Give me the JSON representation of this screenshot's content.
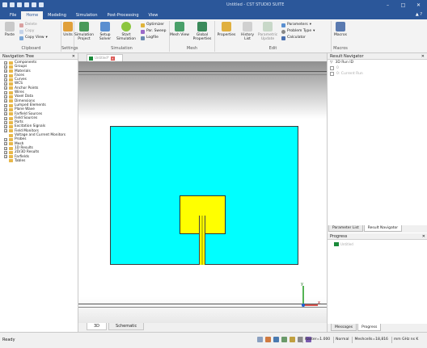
{
  "app": {
    "title": "CST STUDIO SUITE",
    "file_name": "Untitled"
  },
  "ribbon_tabs": [
    "File",
    "Home",
    "Modeling",
    "Simulation",
    "Post-Processing",
    "View"
  ],
  "active_tab": "Home",
  "ribbon": {
    "clipboard": {
      "label": "Clipboard",
      "paste": "Paste",
      "delete": "Delete",
      "copy": "Copy",
      "copy_view": "Copy View"
    },
    "settings": {
      "label": "Settings",
      "units": "Units"
    },
    "simulation": {
      "label": "Simulation",
      "project": "Simulation Project",
      "setup_solver": "Setup Solver",
      "start_simulation": "Start Simulation",
      "optimizer": "Optimizer",
      "par_sweep": "Par. Sweep",
      "logfile": "Logfile"
    },
    "mesh": {
      "label": "Mesh",
      "mesh_view": "Mesh View",
      "global_properties": "Global Properties"
    },
    "edit": {
      "label": "Edit",
      "properties": "Properties",
      "history_list": "History List",
      "parametric_update": "Parametric Update",
      "parameters": "Parameters",
      "problem_type": "Problem Type",
      "calculator": "Calculator"
    },
    "macros": {
      "label": "Macros",
      "macros": "Macros"
    }
  },
  "navigation_tree": {
    "title": "Navigation Tree",
    "items": [
      "Components",
      "Groups",
      "Materials",
      "Faces",
      "Curves",
      "WCS",
      "Anchor Points",
      "Wires",
      "Voxel Data",
      "Dimensions",
      "Lumped Elements",
      "Plane Wave",
      "Farfield Sources",
      "Field Sources",
      "Ports",
      "Excitation Signals",
      "Field Monitors",
      "Voltage and Current Monitors",
      "Probes",
      "Mesh",
      "1D Results",
      "2D/3D Results",
      "Farfields",
      "Tables"
    ]
  },
  "document_tab": {
    "label": "Untitled*"
  },
  "view_tabs": [
    "3D",
    "Schematic"
  ],
  "active_view_tab": "3D",
  "result_navigator": {
    "title": "Result Navigator",
    "items": [
      "3D Run ID",
      "0",
      "0: Current Run"
    ]
  },
  "panel_tabs": [
    "Parameter List",
    "Result Navigator"
  ],
  "active_panel_tab": "Result Navigator",
  "progress": {
    "title": "Progress",
    "item": "Untitled"
  },
  "message_tabs": [
    "Messages",
    "Progress"
  ],
  "active_message_tab": "Progress",
  "axis": {
    "y": "y",
    "x": "x"
  },
  "statusbar": {
    "ready": "Ready",
    "raster": "Raster=1.000",
    "mode": "Normal",
    "meshcells": "Meshcells=18,816",
    "units": "mm GHz ns K"
  },
  "colors": {
    "title_blue": "#2b579a",
    "substrate": "#00ffff",
    "patch": "#ffff00"
  }
}
